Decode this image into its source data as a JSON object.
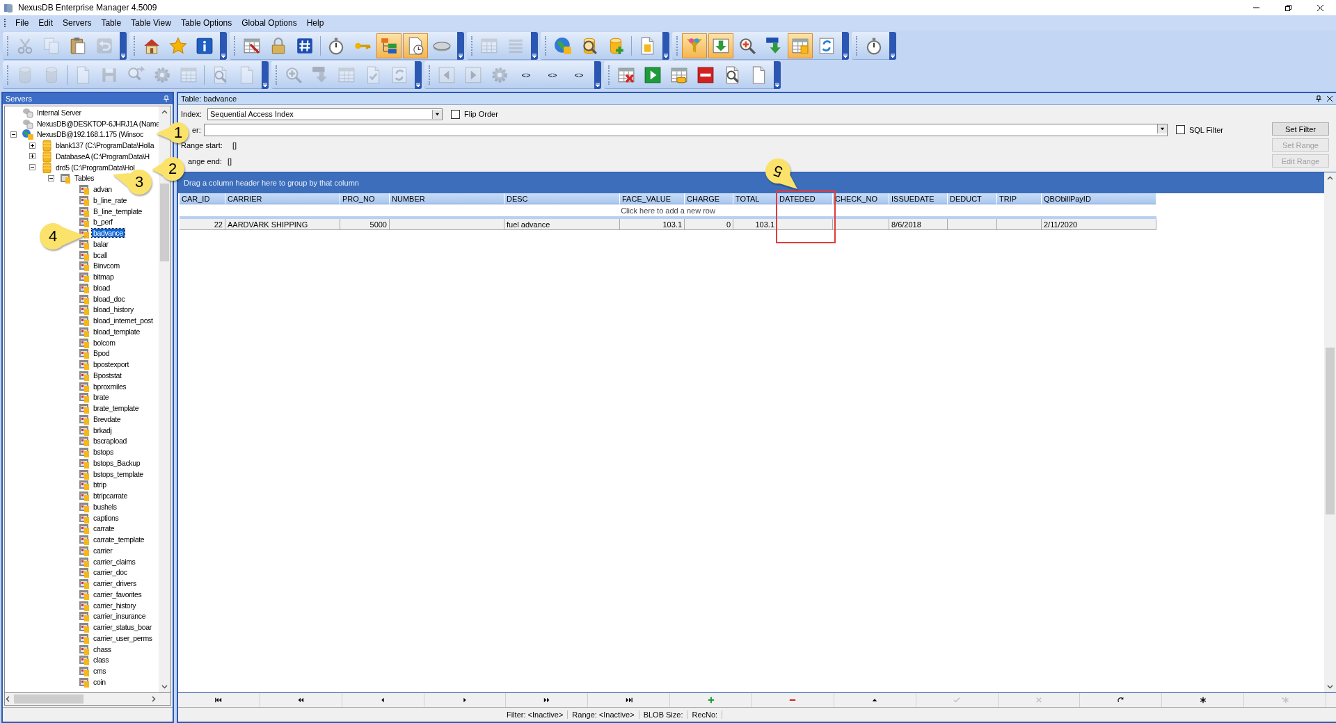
{
  "window": {
    "title": "NexusDB Enterprise Manager 4.5009"
  },
  "menu": [
    "File",
    "Edit",
    "Servers",
    "Table",
    "Table View",
    "Table Options",
    "Global Options",
    "Help"
  ],
  "toolbars": [
    {
      "groups": [
        {
          "buttons": [
            {
              "kind": "cut",
              "disabled": true
            },
            {
              "kind": "copy",
              "disabled": true
            },
            {
              "kind": "paste",
              "disabled": false
            },
            {
              "kind": "undo",
              "disabled": true
            }
          ]
        },
        {
          "buttons": [
            {
              "kind": "home",
              "disabled": false
            },
            {
              "kind": "star",
              "disabled": false
            },
            {
              "kind": "info",
              "disabled": false
            }
          ]
        },
        {
          "buttons": [
            {
              "kind": "tableedit",
              "disabled": false
            },
            {
              "kind": "lock",
              "disabled": false
            },
            {
              "kind": "hash",
              "disabled": false
            },
            {
              "kind": "separator"
            },
            {
              "kind": "stopwatch",
              "disabled": false
            },
            {
              "kind": "key",
              "disabled": false
            },
            {
              "kind": "tree",
              "disabled": false,
              "highlighted": true
            },
            {
              "kind": "calendar",
              "disabled": false,
              "highlighted": true
            },
            {
              "kind": "drive",
              "disabled": false
            }
          ]
        },
        {
          "buttons": [
            {
              "kind": "grid",
              "disabled": true
            },
            {
              "kind": "list",
              "disabled": true
            }
          ]
        },
        {
          "buttons": [
            {
              "kind": "globe",
              "disabled": false
            },
            {
              "kind": "searchdb",
              "disabled": false
            },
            {
              "kind": "dbadd",
              "disabled": false
            },
            {
              "kind": "separator"
            },
            {
              "kind": "docdb",
              "disabled": false
            }
          ]
        },
        {
          "buttons": [
            {
              "kind": "funnel",
              "disabled": false,
              "highlighted": true
            },
            {
              "kind": "import",
              "disabled": false,
              "highlighted": true
            },
            {
              "kind": "zoomin",
              "disabled": false
            },
            {
              "kind": "download",
              "disabled": false
            },
            {
              "kind": "tabledb",
              "disabled": false,
              "highlighted": true
            },
            {
              "kind": "refresh",
              "disabled": false
            }
          ]
        },
        {
          "buttons": [
            {
              "kind": "stopwatch",
              "disabled": false
            }
          ]
        }
      ]
    },
    {
      "groups": [
        {
          "buttons": [
            {
              "kind": "db",
              "disabled": true
            },
            {
              "kind": "db",
              "disabled": true
            },
            {
              "kind": "separator"
            },
            {
              "kind": "doc",
              "disabled": true
            },
            {
              "kind": "save",
              "disabled": true
            },
            {
              "kind": "magarrow",
              "disabled": true
            },
            {
              "kind": "gear",
              "disabled": true
            },
            {
              "kind": "grid",
              "disabled": true
            },
            {
              "kind": "separator"
            },
            {
              "kind": "searchdoc",
              "disabled": true
            },
            {
              "kind": "doc",
              "disabled": true
            }
          ]
        },
        {
          "buttons": [
            {
              "kind": "zoomin",
              "disabled": true
            },
            {
              "kind": "download",
              "disabled": true
            },
            {
              "kind": "grid",
              "disabled": true
            },
            {
              "kind": "checkdoc",
              "disabled": true
            },
            {
              "kind": "refresh",
              "disabled": true
            }
          ]
        },
        {
          "buttons": [
            {
              "kind": "prev",
              "disabled": true
            },
            {
              "kind": "next",
              "disabled": true
            },
            {
              "kind": "gear",
              "disabled": true
            },
            {
              "kind": "text",
              "label": "<>",
              "disabled": false
            },
            {
              "kind": "text",
              "label": "<>",
              "disabled": false
            },
            {
              "kind": "text",
              "label": "<>",
              "disabled": false
            }
          ]
        },
        {
          "buttons": [
            {
              "kind": "tabledel",
              "disabled": false
            },
            {
              "kind": "play",
              "disabled": false
            },
            {
              "kind": "tablelink",
              "disabled": false
            },
            {
              "kind": "minus",
              "disabled": false
            },
            {
              "kind": "searchdoc",
              "disabled": false
            },
            {
              "kind": "doc",
              "disabled": false
            }
          ]
        }
      ]
    }
  ],
  "servers_panel": {
    "title": "Servers",
    "tree": [
      {
        "label": "Internal Server",
        "kind": "server",
        "selected": false
      },
      {
        "label": "NexusDB@DESKTOP-6JHRJ1A (Name",
        "kind": "server",
        "selected": false
      },
      {
        "label": "NexusDB@192.168.1.175 (Winsoc",
        "kind": "remote",
        "expanded": true,
        "selected": false,
        "children": [
          {
            "label": "blank137 (C:\\ProgramData\\Holla",
            "kind": "database",
            "expanded": false,
            "selected": false
          },
          {
            "label": "DatabaseA (C:\\ProgramData\\H",
            "kind": "database",
            "expanded": false,
            "selected": false
          },
          {
            "label": "drd5 (C:\\ProgramData\\Hol",
            "kind": "database",
            "expanded": true,
            "selected": false,
            "children": [
              {
                "label": "Tables",
                "kind": "folder",
                "expanded": true,
                "selected": false,
                "children": [
                  {
                    "label": "advan",
                    "kind": "table",
                    "selected": false
                  },
                  {
                    "label": "b_line_rate",
                    "kind": "table",
                    "selected": false
                  },
                  {
                    "label": "B_line_template",
                    "kind": "table",
                    "selected": false
                  },
                  {
                    "label": "b_perf",
                    "kind": "table",
                    "selected": false
                  },
                  {
                    "label": "badvance",
                    "kind": "table",
                    "selected": true
                  },
                  {
                    "label": "balar",
                    "kind": "table",
                    "selected": false
                  },
                  {
                    "label": "bcall",
                    "kind": "table",
                    "selected": false
                  },
                  {
                    "label": "Binvcom",
                    "kind": "table",
                    "selected": false
                  },
                  {
                    "label": "bitmap",
                    "kind": "table",
                    "selected": false
                  },
                  {
                    "label": "bload",
                    "kind": "table",
                    "selected": false
                  },
                  {
                    "label": "bload_doc",
                    "kind": "table",
                    "selected": false
                  },
                  {
                    "label": "bload_history",
                    "kind": "table",
                    "selected": false
                  },
                  {
                    "label": "bload_internet_post",
                    "kind": "table",
                    "selected": false
                  },
                  {
                    "label": "bload_template",
                    "kind": "table",
                    "selected": false
                  },
                  {
                    "label": "bolcom",
                    "kind": "table",
                    "selected": false
                  },
                  {
                    "label": "Bpod",
                    "kind": "table",
                    "selected": false
                  },
                  {
                    "label": "bpostexport",
                    "kind": "table",
                    "selected": false
                  },
                  {
                    "label": "Bpoststat",
                    "kind": "table",
                    "selected": false
                  },
                  {
                    "label": "bproxmiles",
                    "kind": "table",
                    "selected": false
                  },
                  {
                    "label": "brate",
                    "kind": "table",
                    "selected": false
                  },
                  {
                    "label": "brate_template",
                    "kind": "table",
                    "selected": false
                  },
                  {
                    "label": "Brevdate",
                    "kind": "table",
                    "selected": false
                  },
                  {
                    "label": "brkadj",
                    "kind": "table",
                    "selected": false
                  },
                  {
                    "label": "bscrapload",
                    "kind": "table",
                    "selected": false
                  },
                  {
                    "label": "bstops",
                    "kind": "table",
                    "selected": false
                  },
                  {
                    "label": "bstops_Backup",
                    "kind": "table",
                    "selected": false
                  },
                  {
                    "label": "bstops_template",
                    "kind": "table",
                    "selected": false
                  },
                  {
                    "label": "btrip",
                    "kind": "table",
                    "selected": false
                  },
                  {
                    "label": "btripcarrate",
                    "kind": "table",
                    "selected": false
                  },
                  {
                    "label": "bushels",
                    "kind": "table",
                    "selected": false
                  },
                  {
                    "label": "captions",
                    "kind": "table",
                    "selected": false
                  },
                  {
                    "label": "carrate",
                    "kind": "table",
                    "selected": false
                  },
                  {
                    "label": "carrate_template",
                    "kind": "table",
                    "selected": false
                  },
                  {
                    "label": "carrier",
                    "kind": "table",
                    "selected": false
                  },
                  {
                    "label": "carrier_claims",
                    "kind": "table",
                    "selected": false
                  },
                  {
                    "label": "carrier_doc",
                    "kind": "table",
                    "selected": false
                  },
                  {
                    "label": "carrier_drivers",
                    "kind": "table",
                    "selected": false
                  },
                  {
                    "label": "carrier_favorites",
                    "kind": "table",
                    "selected": false
                  },
                  {
                    "label": "carrier_history",
                    "kind": "table",
                    "selected": false
                  },
                  {
                    "label": "carrier_insurance",
                    "kind": "table",
                    "selected": false
                  },
                  {
                    "label": "carrier_status_boar",
                    "kind": "table",
                    "selected": false
                  },
                  {
                    "label": "carrier_user_perms",
                    "kind": "table",
                    "selected": false
                  },
                  {
                    "label": "chass",
                    "kind": "table",
                    "selected": false
                  },
                  {
                    "label": "class",
                    "kind": "table",
                    "selected": false
                  },
                  {
                    "label": "cms",
                    "kind": "table",
                    "selected": false
                  },
                  {
                    "label": "coin",
                    "kind": "table",
                    "selected": false
                  }
                ]
              }
            ]
          }
        ]
      }
    ]
  },
  "table_panel": {
    "title": "Table: badvance",
    "index_label": "Index:",
    "index_value": "Sequential Access Index",
    "flip_order": {
      "label": "Flip Order",
      "checked": false
    },
    "filter_label": "er:",
    "sql_filter": {
      "label": "SQL Filter",
      "checked": false
    },
    "range_start_label": "Range start:",
    "range_start_value": "[]",
    "range_end_label": "ange end:",
    "range_end_value": "[]",
    "buttons": [
      {
        "label": "Set Filter",
        "disabled": false
      },
      {
        "label": "Set Range",
        "disabled": true
      },
      {
        "label": "Edit Range",
        "disabled": true
      }
    ]
  },
  "grid": {
    "group_hint": "Drag a column header here to group by that column",
    "columns": [
      {
        "label": "CAR_ID",
        "highlighted": false
      },
      {
        "label": "CARRIER",
        "highlighted": false
      },
      {
        "label": "PRO_NO",
        "highlighted": false
      },
      {
        "label": "NUMBER",
        "highlighted": false
      },
      {
        "label": "DESC",
        "highlighted": false
      },
      {
        "label": "FACE_VALUE",
        "highlighted": false
      },
      {
        "label": "CHARGE",
        "highlighted": false
      },
      {
        "label": "TOTAL",
        "highlighted": false
      },
      {
        "label": "DATEDED",
        "highlighted": true
      },
      {
        "label": "CHECK_NO",
        "highlighted": false
      },
      {
        "label": "ISSUEDATE",
        "highlighted": false
      },
      {
        "label": "DEDUCT",
        "highlighted": false
      },
      {
        "label": "TRIP",
        "highlighted": false
      },
      {
        "label": "QBObillPayID",
        "highlighted": false
      }
    ],
    "new_row_hint": "Click here to add a new row",
    "rows": [
      [
        "22",
        "AARDVARK SHIPPING",
        "5000",
        "",
        "fuel advance",
        "103.1",
        "0",
        "103.1",
        "",
        "",
        "8/6/2018",
        "",
        "",
        "2/11/2020"
      ]
    ]
  },
  "navigator": [
    {
      "kind": "first",
      "disabled": false
    },
    {
      "kind": "prior_page",
      "disabled": false
    },
    {
      "kind": "prior",
      "disabled": false
    },
    {
      "kind": "next",
      "disabled": false
    },
    {
      "kind": "next_page",
      "disabled": false
    },
    {
      "kind": "last",
      "disabled": false
    },
    {
      "kind": "insert",
      "disabled": false
    },
    {
      "kind": "delete",
      "disabled": false
    },
    {
      "kind": "edit",
      "disabled": false
    },
    {
      "kind": "post",
      "disabled": true
    },
    {
      "kind": "cancel",
      "disabled": true
    },
    {
      "kind": "refresh",
      "disabled": false
    },
    {
      "kind": "bookmark",
      "disabled": false
    },
    {
      "kind": "goto_bookmark",
      "disabled": true
    }
  ],
  "status_bar": [
    "Filter: <Inactive>",
    "Range: <Inactive>",
    "BLOB Size:",
    "RecNo:"
  ],
  "callouts": [
    {
      "label": "1"
    },
    {
      "label": "2"
    },
    {
      "label": "3"
    },
    {
      "label": "4"
    },
    {
      "label": "5"
    }
  ]
}
